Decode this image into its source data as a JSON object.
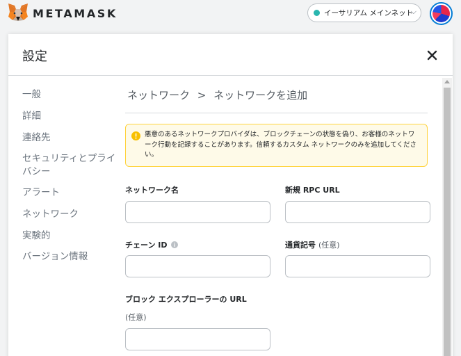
{
  "header": {
    "brand": "METAMASK",
    "network": "イーサリアム メインネット",
    "logo_icon": "metamask-fox-icon",
    "avatar_icon": "account-identicon"
  },
  "settings": {
    "title": "設定",
    "close_icon": "close-icon",
    "sidebar": {
      "items": [
        {
          "label": "一般"
        },
        {
          "label": "詳細"
        },
        {
          "label": "連絡先"
        },
        {
          "label": "セキュリティとプライバシー"
        },
        {
          "label": "アラート"
        },
        {
          "label": "ネットワーク"
        },
        {
          "label": "実験的"
        },
        {
          "label": "バージョン情報"
        }
      ]
    },
    "breadcrumb": {
      "parent": "ネットワーク",
      "separator": ">",
      "current": "ネットワークを追加"
    },
    "warning": {
      "text": "悪意のあるネットワークプロバイダは、ブロックチェーンの状態を偽り、お客様のネットワーク行動を記録することがあります。信頼するカスタム ネットワークのみを追加してください。",
      "icon": "warning-info-icon",
      "accent": "#ffd33d"
    },
    "form": {
      "network_name": {
        "label": "ネットワーク名",
        "value": ""
      },
      "rpc_url": {
        "label": "新規 RPC URL",
        "value": ""
      },
      "chain_id": {
        "label": "チェーン ID",
        "value": "",
        "info_icon": "info-icon"
      },
      "currency_symbol": {
        "label": "通貨記号",
        "optional": "(任意)",
        "value": ""
      },
      "explorer_url": {
        "label": "ブロック エクスプローラーの URL",
        "optional": "(任意)",
        "value": ""
      }
    }
  },
  "colors": {
    "network_dot": "#29b6af",
    "primary": "#037dd6",
    "warning_bg": "#fefae8"
  }
}
